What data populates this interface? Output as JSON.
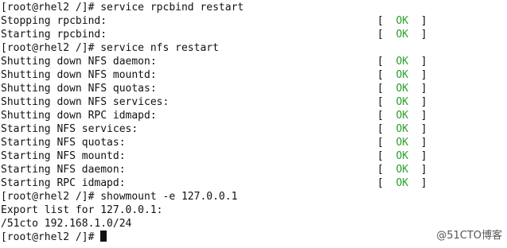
{
  "terminal": {
    "lines": [
      {
        "text": "[root@rhel2 /]# service rpcbind restart"
      },
      {
        "text": "Stopping rpcbind:",
        "status": "OK"
      },
      {
        "text": "Starting rpcbind:",
        "status": "OK"
      },
      {
        "text": "[root@rhel2 /]# service nfs restart"
      },
      {
        "text": "Shutting down NFS daemon:",
        "status": "OK"
      },
      {
        "text": "Shutting down NFS mountd:",
        "status": "OK"
      },
      {
        "text": "Shutting down NFS quotas:",
        "status": "OK"
      },
      {
        "text": "Shutting down NFS services:",
        "status": "OK"
      },
      {
        "text": "Shutting down RPC idmapd:",
        "status": "OK"
      },
      {
        "text": "Starting NFS services:",
        "status": "OK"
      },
      {
        "text": "Starting NFS quotas:",
        "status": "OK"
      },
      {
        "text": "Starting NFS mountd:",
        "status": "OK"
      },
      {
        "text": "Starting NFS daemon:",
        "status": "OK"
      },
      {
        "text": "Starting RPC idmapd:",
        "status": "OK"
      },
      {
        "text": "[root@rhel2 /]# showmount -e 127.0.0.1"
      },
      {
        "text": "Export list for 127.0.0.1:"
      },
      {
        "text": "/51cto 192.168.1.0/24"
      },
      {
        "text": "[root@rhel2 /]# ",
        "cursor": true
      }
    ],
    "bracket_open": "[",
    "bracket_close": "]",
    "ok_color": "#2ca02c"
  },
  "watermark": {
    "text": "@51CTO博客"
  }
}
